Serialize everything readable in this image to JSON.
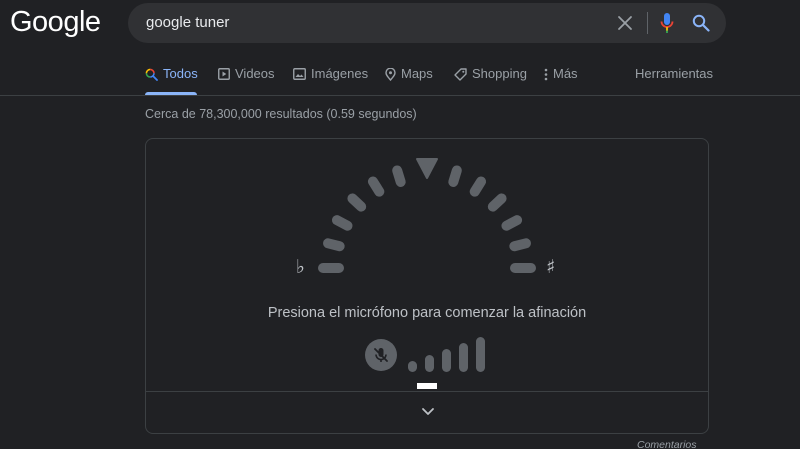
{
  "header": {
    "logo_text": "Google",
    "search": {
      "value": "google tuner"
    }
  },
  "tabs": [
    {
      "label": "Todos",
      "icon": "search-color-icon",
      "active": true
    },
    {
      "label": "Videos",
      "icon": "video-icon",
      "active": false
    },
    {
      "label": "Imágenes",
      "icon": "image-icon",
      "active": false
    },
    {
      "label": "Maps",
      "icon": "map-pin-icon",
      "active": false
    },
    {
      "label": "Shopping",
      "icon": "tag-icon",
      "active": false
    },
    {
      "label": "Más",
      "icon": "more-vert-icon",
      "active": false
    },
    {
      "label": "Herramientas",
      "active": false
    }
  ],
  "results": {
    "count_text": "Cerca de 78,300,000 resultados (0.59 segundos)"
  },
  "tuner": {
    "note": "–",
    "flat_symbol": "♭",
    "sharp_symbol": "♯",
    "instruction": "Presiona el micrófono para comenzar la afinación",
    "mic_state": "off",
    "level_bar_count": 5
  },
  "footer": {
    "feedback_label": "Comentarios"
  },
  "colors": {
    "background": "#202124",
    "accent": "#8ab4f8",
    "gauge": "#5f6368",
    "card_border": "#3c4043"
  }
}
